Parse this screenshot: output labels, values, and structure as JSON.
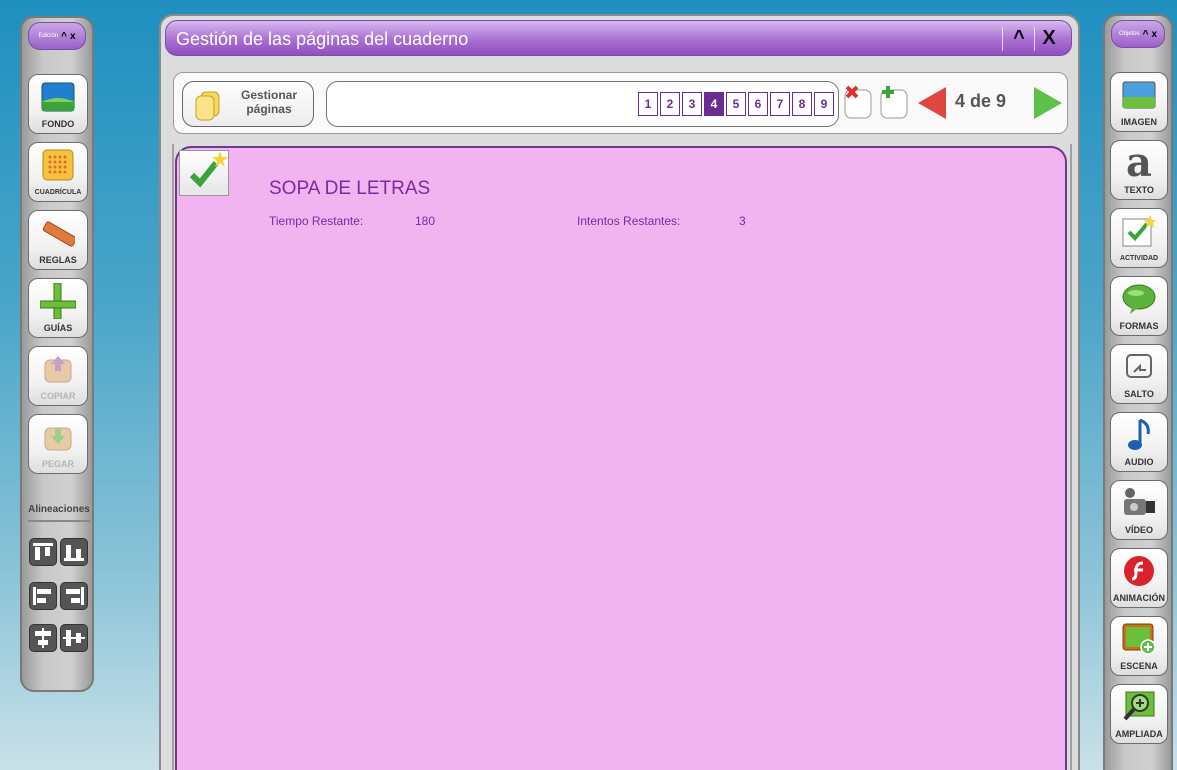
{
  "left_panel": {
    "title": "Edición",
    "minimize": "^",
    "close": "x",
    "tools": [
      {
        "label": "FONDO"
      },
      {
        "label": "CUADRÍCULA"
      },
      {
        "label": "REGLAS"
      },
      {
        "label": "GUÍAS"
      },
      {
        "label": "COPIAR"
      },
      {
        "label": "PEGAR"
      }
    ],
    "alignments_label": "Alineaciones"
  },
  "right_panel": {
    "title": "Objetos",
    "minimize": "^",
    "close": "x",
    "tools": [
      {
        "label": "IMAGEN"
      },
      {
        "label": "TEXTO"
      },
      {
        "label": "ACTIVIDAD"
      },
      {
        "label": "FORMAS"
      },
      {
        "label": "SALTO"
      },
      {
        "label": "AUDIO"
      },
      {
        "label": "VÍDEO"
      },
      {
        "label": "ANIMACIÓN"
      },
      {
        "label": "ESCENA"
      },
      {
        "label": "AMPLIADA"
      }
    ]
  },
  "window": {
    "title": "Gestión de las páginas del cuaderno",
    "minimize": "^",
    "close": "X"
  },
  "toolbar": {
    "manage_label_1": "Gestionar",
    "manage_label_2": "páginas",
    "pages": [
      "1",
      "2",
      "3",
      "4",
      "5",
      "6",
      "7",
      "8",
      "9"
    ],
    "current_page": 4,
    "page_count": "4 de 9"
  },
  "activity": {
    "title": "SOPA DE LETRAS",
    "time_label": "Tiempo Restante:",
    "time_value": "180",
    "tries_label": "Intentos Restantes:",
    "tries_value": "3"
  },
  "colors": {
    "accent": "#9b5fc9",
    "page_active": "#6a2d92",
    "content_bg": "#f1b4f1",
    "activity_text": "#7b2aa0"
  }
}
